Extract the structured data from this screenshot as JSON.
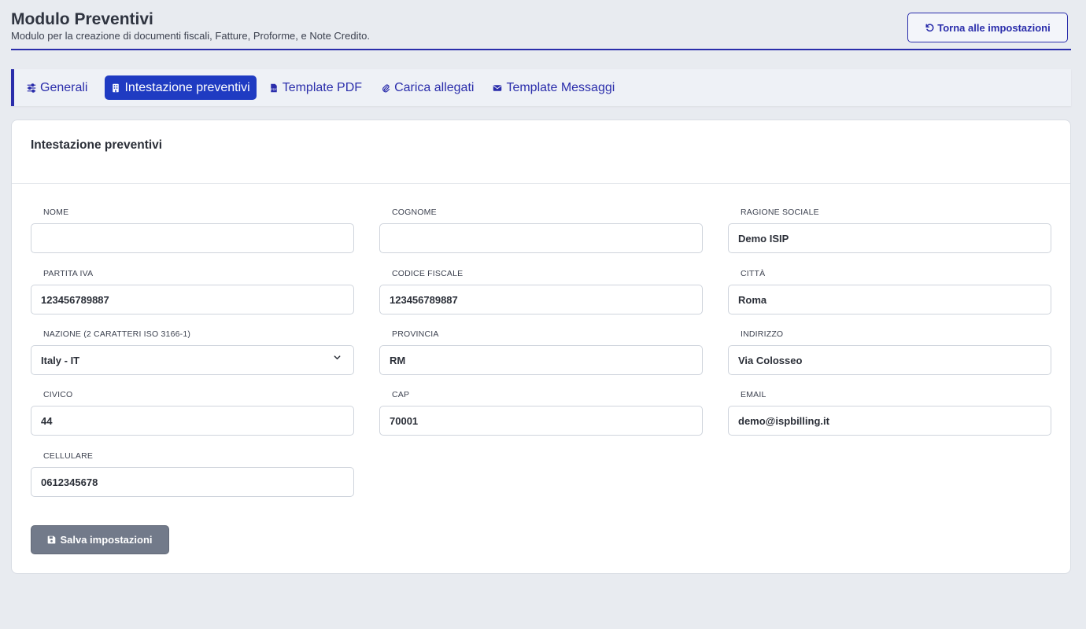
{
  "header": {
    "title": "Modulo Preventivi",
    "subtitle": "Modulo per la creazione di documenti fiscali, Fatture, Proforme, e Note Credito.",
    "back_button_label": "Torna alle impostazioni"
  },
  "tabs": [
    {
      "label": "Generali",
      "icon": "sliders-icon",
      "active": false
    },
    {
      "label": "Intestazione preventivi",
      "icon": "building-icon",
      "active": true
    },
    {
      "label": "Template PDF",
      "icon": "pdf-file-icon",
      "active": false
    },
    {
      "label": "Carica allegati",
      "icon": "paperclip-icon",
      "active": false
    },
    {
      "label": "Template Messaggi",
      "icon": "envelope-icon",
      "active": false
    }
  ],
  "card": {
    "title": "Intestazione preventivi",
    "fields": {
      "nome": {
        "label": "Nome",
        "value": ""
      },
      "cognome": {
        "label": "Cognome",
        "value": ""
      },
      "ragione_sociale": {
        "label": "Ragione sociale",
        "value": "Demo ISIP"
      },
      "partita_iva": {
        "label": "Partita IVA",
        "value": "123456789887"
      },
      "codice_fiscale": {
        "label": "Codice fiscale",
        "value": "123456789887"
      },
      "citta": {
        "label": "Città",
        "value": "Roma"
      },
      "nazione": {
        "label": "Nazione (2 caratteri ISO 3166-1)",
        "value": "Italy - IT"
      },
      "provincia": {
        "label": "Provincia",
        "value": "RM"
      },
      "indirizzo": {
        "label": "Indirizzo",
        "value": "Via Colosseo"
      },
      "civico": {
        "label": "Civico",
        "value": "44"
      },
      "cap": {
        "label": "CAP",
        "value": "70001"
      },
      "email": {
        "label": "Email",
        "value": "demo@ispbilling.it"
      },
      "cellulare": {
        "label": "Cellulare",
        "value": "0612345678"
      }
    },
    "save_button_label": "Salva impostazioni"
  },
  "colors": {
    "accent": "#2a2dab",
    "active_tab": "#1f3bc2",
    "save_button": "#727a8a",
    "background": "#e8ebf0"
  }
}
